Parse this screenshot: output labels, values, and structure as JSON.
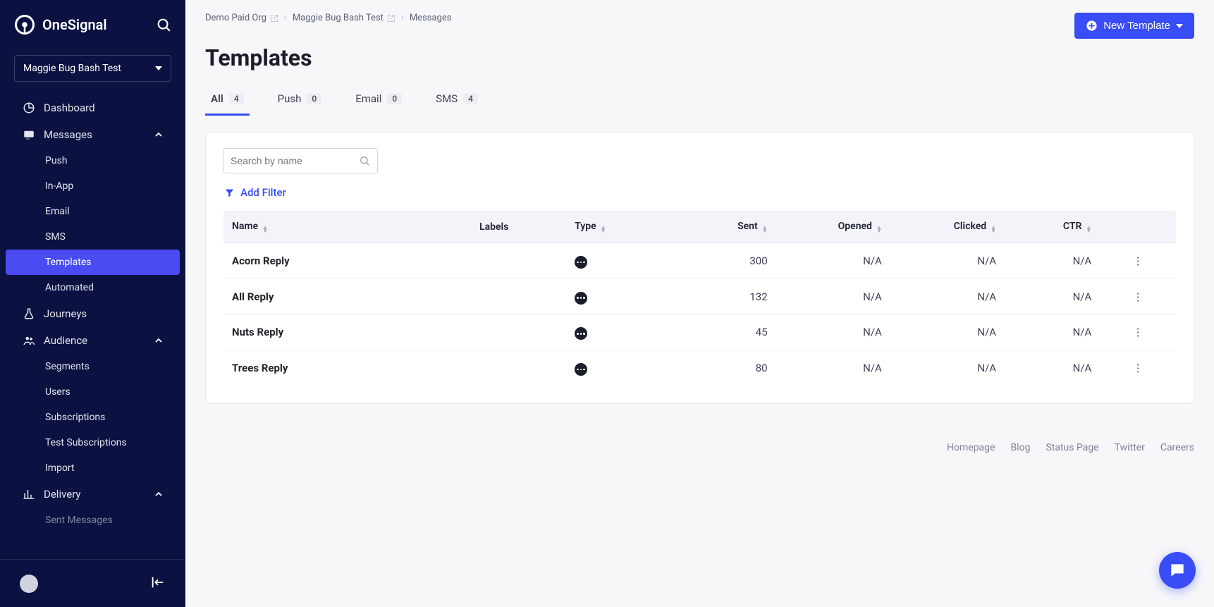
{
  "brand": {
    "name": "OneSignal"
  },
  "app_selector": {
    "current": "Maggie Bug Bash Test"
  },
  "sidebar": {
    "dashboard": "Dashboard",
    "messages": "Messages",
    "messages_children": {
      "push": "Push",
      "inapp": "In-App",
      "email": "Email",
      "sms": "SMS",
      "templates": "Templates",
      "automated": "Automated"
    },
    "journeys": "Journeys",
    "audience": "Audience",
    "audience_children": {
      "segments": "Segments",
      "users": "Users",
      "subscriptions": "Subscriptions",
      "test_subscriptions": "Test Subscriptions",
      "import": "Import"
    },
    "delivery": "Delivery",
    "delivery_children": {
      "sent_messages": "Sent Messages"
    }
  },
  "breadcrumb": {
    "org": "Demo Paid Org",
    "app": "Maggie Bug Bash Test",
    "section": "Messages"
  },
  "page_title": "Templates",
  "new_template_btn": "New Template",
  "tabs": {
    "all": {
      "label": "All",
      "count": "4"
    },
    "push": {
      "label": "Push",
      "count": "0"
    },
    "email": {
      "label": "Email",
      "count": "0"
    },
    "sms": {
      "label": "SMS",
      "count": "4"
    }
  },
  "search": {
    "placeholder": "Search by name"
  },
  "add_filter": "Add Filter",
  "table": {
    "headers": {
      "name": "Name",
      "labels": "Labels",
      "type": "Type",
      "sent": "Sent",
      "opened": "Opened",
      "clicked": "Clicked",
      "ctr": "CTR"
    },
    "rows": [
      {
        "name": "Acorn Reply",
        "labels": "",
        "type": "sms",
        "sent": "300",
        "opened": "N/A",
        "clicked": "N/A",
        "ctr": "N/A"
      },
      {
        "name": "All Reply",
        "labels": "",
        "type": "sms",
        "sent": "132",
        "opened": "N/A",
        "clicked": "N/A",
        "ctr": "N/A"
      },
      {
        "name": "Nuts Reply",
        "labels": "",
        "type": "sms",
        "sent": "45",
        "opened": "N/A",
        "clicked": "N/A",
        "ctr": "N/A"
      },
      {
        "name": "Trees Reply",
        "labels": "",
        "type": "sms",
        "sent": "80",
        "opened": "N/A",
        "clicked": "N/A",
        "ctr": "N/A"
      }
    ]
  },
  "footer": {
    "homepage": "Homepage",
    "blog": "Blog",
    "status": "Status Page",
    "twitter": "Twitter",
    "careers": "Careers"
  }
}
